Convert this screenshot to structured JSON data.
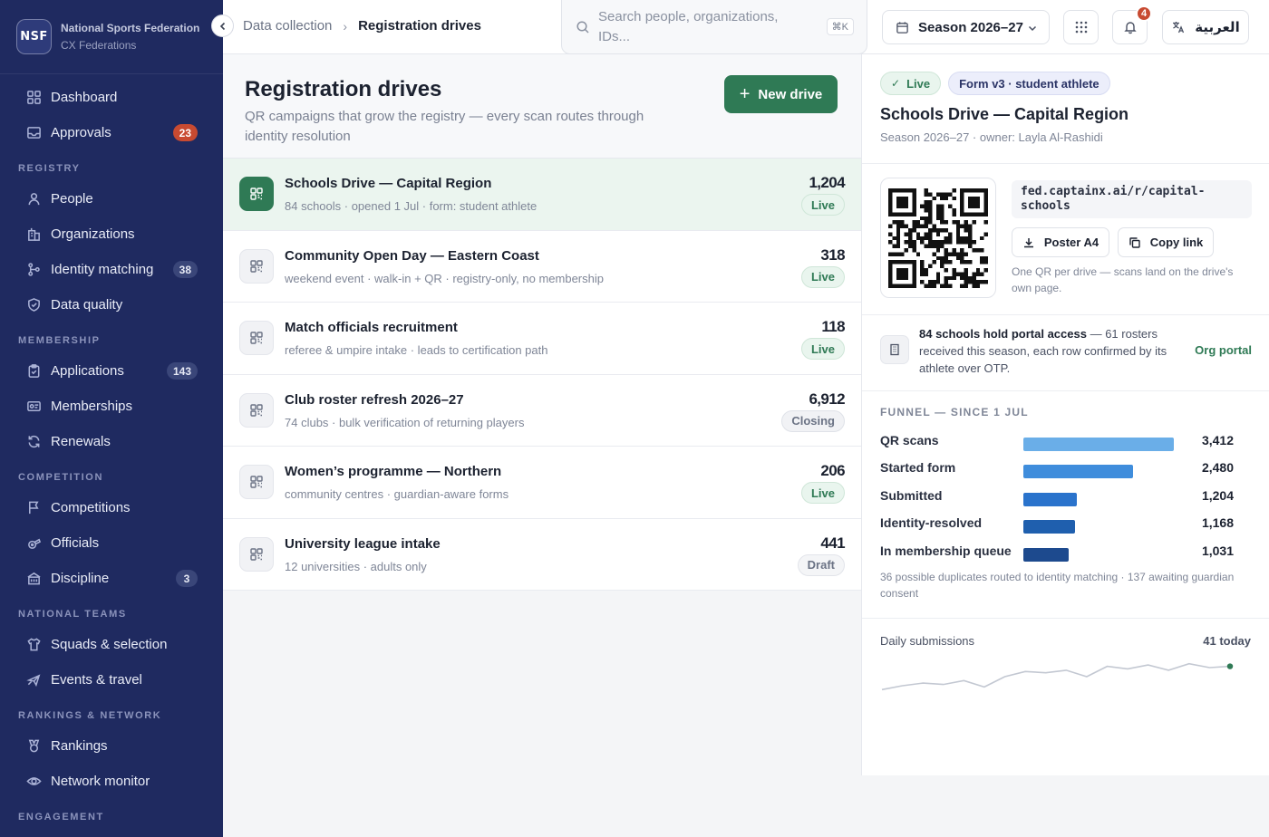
{
  "brand": {
    "logo": "NSF",
    "name": "National Sports Federation",
    "sub": "CX Federations"
  },
  "sidebar": {
    "items_top": [
      {
        "label": "Dashboard",
        "icon": "grid-icon"
      },
      {
        "label": "Approvals",
        "icon": "inbox-icon",
        "badge": "23",
        "badge_style": "red"
      }
    ],
    "sections": [
      {
        "label": "REGISTRY",
        "items": [
          {
            "label": "People",
            "icon": "person-icon"
          },
          {
            "label": "Organizations",
            "icon": "building-icon"
          },
          {
            "label": "Identity matching",
            "icon": "branch-icon",
            "badge": "38"
          },
          {
            "label": "Data quality",
            "icon": "shield-icon"
          }
        ]
      },
      {
        "label": "MEMBERSHIP",
        "items": [
          {
            "label": "Applications",
            "icon": "clipboard-icon",
            "badge": "143"
          },
          {
            "label": "Memberships",
            "icon": "id-card-icon"
          },
          {
            "label": "Renewals",
            "icon": "refresh-icon"
          }
        ]
      },
      {
        "label": "COMPETITION",
        "items": [
          {
            "label": "Competitions",
            "icon": "flag-icon"
          },
          {
            "label": "Officials",
            "icon": "whistle-icon"
          },
          {
            "label": "Discipline",
            "icon": "gavel-icon",
            "badge": "3"
          }
        ]
      },
      {
        "label": "NATIONAL TEAMS",
        "items": [
          {
            "label": "Squads & selection",
            "icon": "shirt-icon"
          },
          {
            "label": "Events & travel",
            "icon": "plane-icon"
          }
        ]
      },
      {
        "label": "RANKINGS & NETWORK",
        "items": [
          {
            "label": "Rankings",
            "icon": "medal-icon"
          },
          {
            "label": "Network monitor",
            "icon": "eye-icon"
          }
        ]
      },
      {
        "label": "ENGAGEMENT",
        "items": []
      }
    ]
  },
  "topbar": {
    "breadcrumb_parent": "Data collection",
    "breadcrumb_current": "Registration drives",
    "search_placeholder": "Search people, organizations, IDs...",
    "search_shortcut": "⌘K",
    "season": "Season 2026–27",
    "notification_count": "4",
    "language": "العربية"
  },
  "main": {
    "title": "Registration drives",
    "description": "QR campaigns that grow the registry — every scan routes through identity resolution",
    "new_button": "New drive",
    "drives": [
      {
        "title": "Schools Drive — Capital Region",
        "sub": "84 schools · opened 1 Jul · form: student athlete",
        "count": "1,204",
        "status": "Live",
        "status_style": "live",
        "active": true
      },
      {
        "title": "Community Open Day — Eastern Coast",
        "sub": "weekend event · walk-in + QR · registry-only, no membership",
        "count": "318",
        "status": "Live",
        "status_style": "live",
        "active": false
      },
      {
        "title": "Match officials recruitment",
        "sub": "referee & umpire intake · leads to certification path",
        "count": "118",
        "status": "Live",
        "status_style": "live",
        "active": false
      },
      {
        "title": "Club roster refresh 2026–27",
        "sub": "74 clubs · bulk verification of returning players",
        "count": "6,912",
        "status": "Closing",
        "status_style": "closing",
        "active": false
      },
      {
        "title": "Women’s programme — Northern",
        "sub": "community centres · guardian-aware forms",
        "count": "206",
        "status": "Live",
        "status_style": "live",
        "active": false
      },
      {
        "title": "University league intake",
        "sub": "12 universities · adults only",
        "count": "441",
        "status": "Draft",
        "status_style": "draft",
        "active": false
      }
    ]
  },
  "detail": {
    "chip_live": "Live",
    "chip_form": "Form v3 · student athlete",
    "title": "Schools Drive — Capital Region",
    "sub": "Season 2026–27 · owner: Layla Al-Rashidi",
    "url": "fed.captainx.ai/r/capital-schools",
    "poster_button": "Poster A4",
    "copy_button": "Copy link",
    "qr_note": "One QR per drive — scans land on the drive's own page.",
    "portal_bold": "84 schools hold portal access",
    "portal_rest": " — 61 rosters received this season, each row confirmed by its athlete over OTP.",
    "portal_link": "Org portal",
    "funnel_label": "FUNNEL — SINCE 1 JUL",
    "funnel": [
      {
        "name": "QR scans",
        "value": "3,412",
        "num": 3412,
        "color": "#6aaee8"
      },
      {
        "name": "Started form",
        "value": "2,480",
        "num": 2480,
        "color": "#3f8ddc"
      },
      {
        "name": "Submitted",
        "value": "1,204",
        "num": 1204,
        "color": "#2a73cc"
      },
      {
        "name": "Identity-resolved",
        "value": "1,168",
        "num": 1168,
        "color": "#1f5fae"
      },
      {
        "name": "In membership queue",
        "value": "1,031",
        "num": 1031,
        "color": "#1d4a8e"
      }
    ],
    "funnel_note": "36 possible duplicates routed to identity matching · 137 awaiting guardian consent",
    "daily_label": "Daily submissions",
    "daily_today": "41 today",
    "daily_series": [
      28,
      31,
      33,
      32,
      35,
      30,
      38,
      42,
      41,
      43,
      38,
      46,
      44,
      47,
      43,
      48,
      45,
      46
    ]
  }
}
